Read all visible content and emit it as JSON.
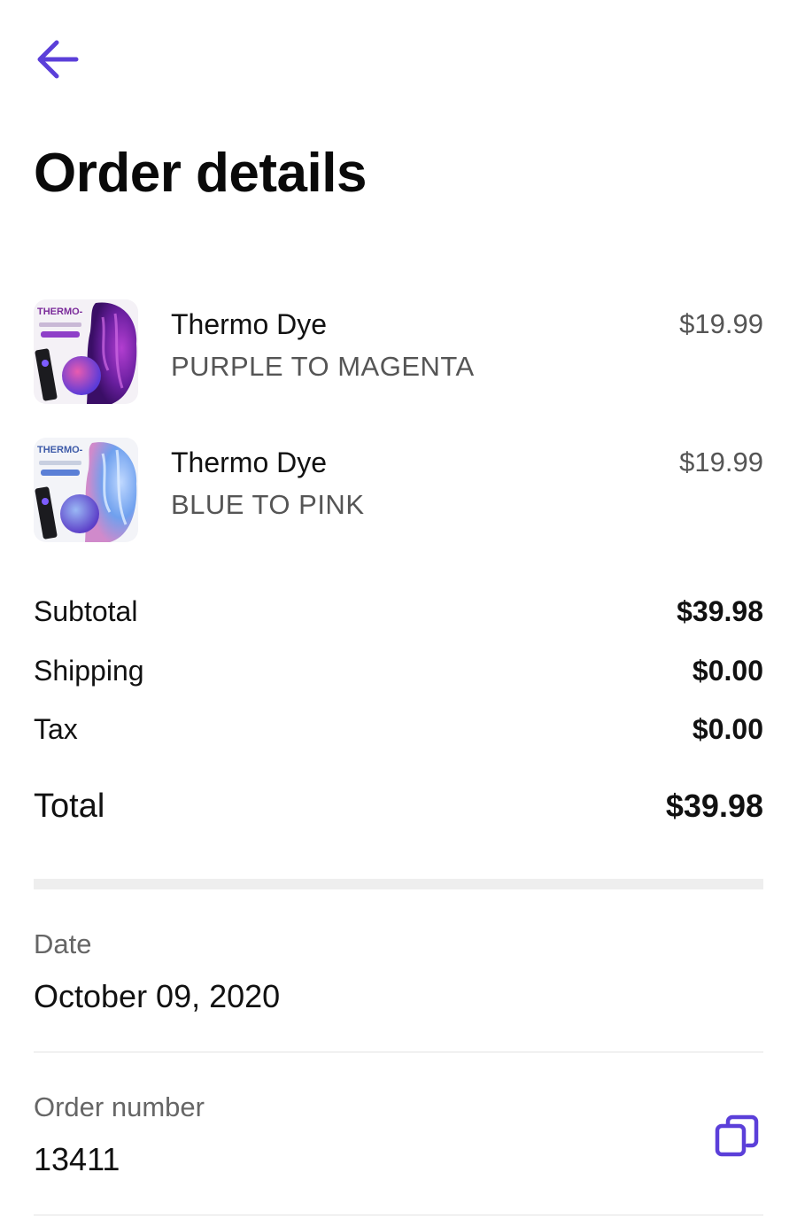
{
  "header": {
    "back_icon": "arrow-left-icon",
    "title": "Order details",
    "accent_color": "#5B3FD9"
  },
  "items": [
    {
      "thumbnail_text": "THERMO-",
      "name": "Thermo Dye",
      "variant": "PURPLE TO MAGENTA",
      "price": "$19.99"
    },
    {
      "thumbnail_text": "THERMO-",
      "name": "Thermo Dye",
      "variant": "BLUE TO PINK",
      "price": "$19.99"
    }
  ],
  "summary": {
    "subtotal_label": "Subtotal",
    "subtotal_value": "$39.98",
    "shipping_label": "Shipping",
    "shipping_value": "$0.00",
    "tax_label": "Tax",
    "tax_value": "$0.00",
    "total_label": "Total",
    "total_value": "$39.98"
  },
  "date": {
    "label": "Date",
    "value": "October 09, 2020"
  },
  "order_number": {
    "label": "Order number",
    "value": "13411",
    "copy_icon": "copy-icon"
  }
}
